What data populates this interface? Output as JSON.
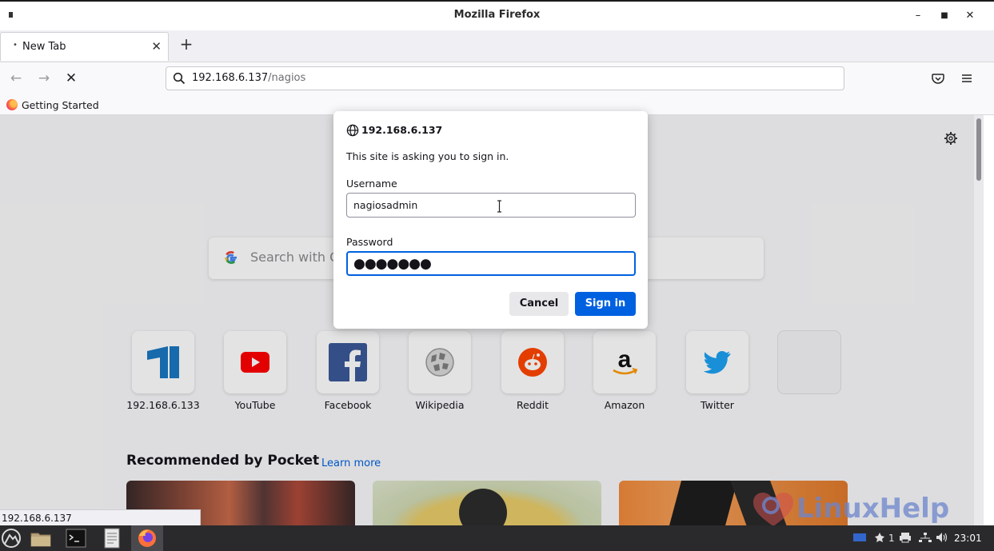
{
  "window": {
    "title": "Mozilla Firefox"
  },
  "tabs": [
    {
      "label": "New Tab",
      "active": true
    }
  ],
  "urlbar": {
    "host": "192.168.6.137",
    "path": "/nagios"
  },
  "bookmarks": [
    {
      "label": "Getting Started"
    }
  ],
  "newtab": {
    "search_placeholder": "Search with Go",
    "top_sites": [
      {
        "name": "192.168.6.133",
        "icon": "nagios-icon"
      },
      {
        "name": "YouTube",
        "icon": "youtube-icon"
      },
      {
        "name": "Facebook",
        "icon": "facebook-icon"
      },
      {
        "name": "Wikipedia",
        "icon": "wikipedia-icon"
      },
      {
        "name": "Reddit",
        "icon": "reddit-icon"
      },
      {
        "name": "Amazon",
        "icon": "amazon-icon"
      },
      {
        "name": "Twitter",
        "icon": "twitter-icon"
      },
      {
        "name": "",
        "icon": ""
      }
    ],
    "pocket_heading": "Recommended by Pocket",
    "pocket_learn_more": "Learn more"
  },
  "status_url": "192.168.6.137",
  "auth_dialog": {
    "host": "192.168.6.137",
    "message": "This site is asking you to sign in.",
    "username_label": "Username",
    "username_value": "nagiosadmin",
    "password_label": "Password",
    "password_value": "●●●●●●●",
    "cancel_label": "Cancel",
    "signin_label": "Sign in"
  },
  "watermark": "LinuxHelp",
  "taskbar": {
    "tray_counter": "1",
    "clock": "23:01"
  },
  "colors": {
    "accent": "#0061e0",
    "taskbar": "#2a2a2c"
  }
}
